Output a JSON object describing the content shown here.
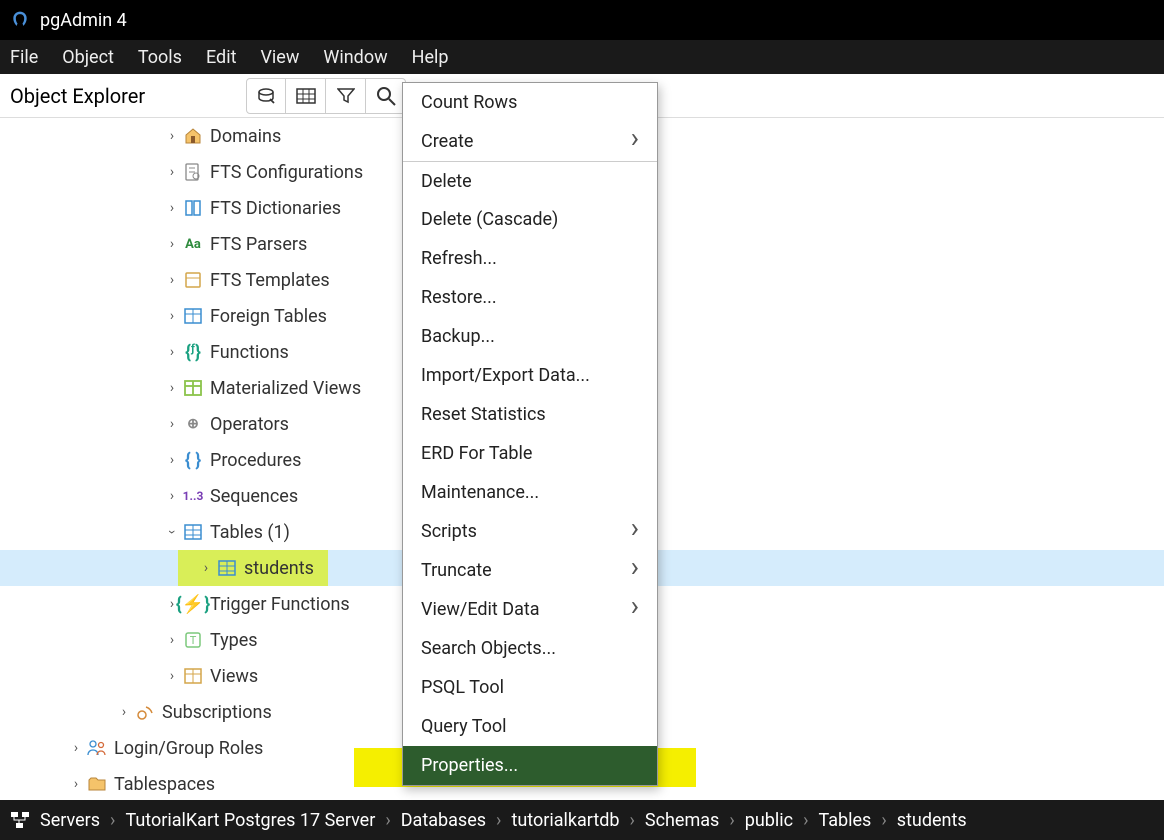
{
  "app": {
    "title": "pgAdmin 4"
  },
  "menubar": [
    "File",
    "Object",
    "Tools",
    "Edit",
    "View",
    "Window",
    "Help"
  ],
  "explorer": {
    "title": "Object Explorer"
  },
  "tree": {
    "domains": "Domains",
    "fts_cfg": "FTS Configurations",
    "fts_dict": "FTS Dictionaries",
    "fts_parsers": "FTS Parsers",
    "fts_templates": "FTS Templates",
    "foreign_tables": "Foreign Tables",
    "functions": "Functions",
    "mat_views": "Materialized Views",
    "operators": "Operators",
    "procedures": "Procedures",
    "sequences": "Sequences",
    "tables": "Tables (1)",
    "students": "students",
    "trigger_fns": "Trigger Functions",
    "types": "Types",
    "views": "Views",
    "subscriptions": "Subscriptions",
    "login_roles": "Login/Group Roles",
    "tablespaces": "Tablespaces"
  },
  "context": [
    "Count Rows",
    "Create",
    "Delete",
    "Delete (Cascade)",
    "Refresh...",
    "Restore...",
    "Backup...",
    "Import/Export Data...",
    "Reset Statistics",
    "ERD For Table",
    "Maintenance...",
    "Scripts",
    "Truncate",
    "View/Edit Data",
    "Search Objects...",
    "PSQL Tool",
    "Query Tool",
    "Properties..."
  ],
  "breadcrumb": [
    "Servers",
    "TutorialKart Postgres 17 Server",
    "Databases",
    "tutorialkartdb",
    "Schemas",
    "public",
    "Tables",
    "students"
  ]
}
